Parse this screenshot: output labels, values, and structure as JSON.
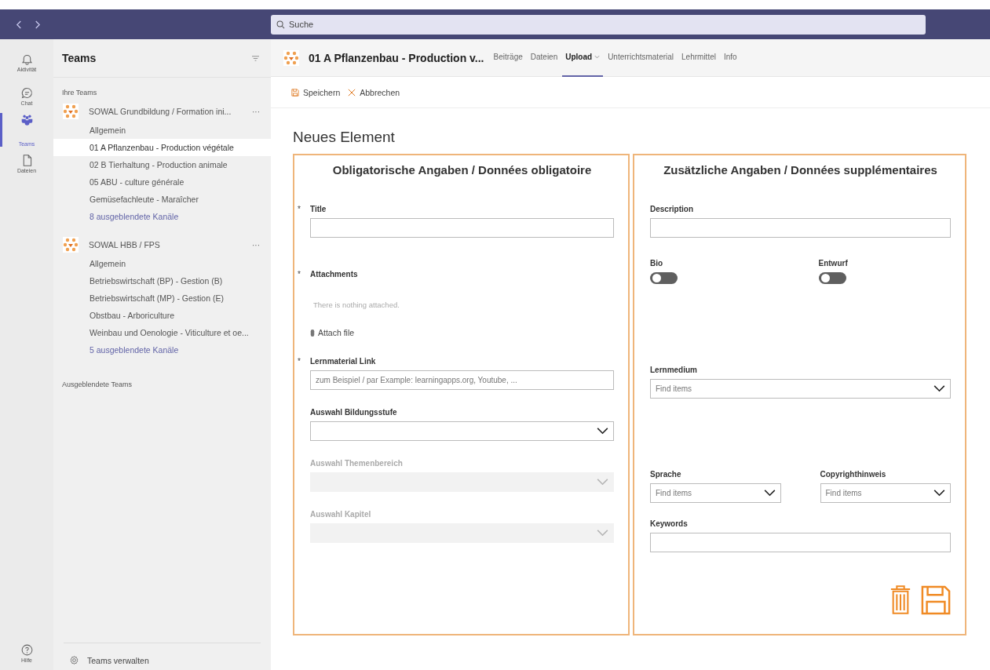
{
  "search": {
    "placeholder": "Suche"
  },
  "rail": {
    "items": [
      {
        "label": "Aktivität",
        "kind": "bell",
        "selected": false
      },
      {
        "label": "Chat",
        "kind": "chat",
        "selected": false
      },
      {
        "label": "Teams",
        "kind": "people",
        "selected": true
      },
      {
        "label": "Dateien",
        "kind": "file",
        "selected": false
      }
    ],
    "help": {
      "label": "Hilfe"
    }
  },
  "teams_panel": {
    "title": "Teams",
    "section": "Ihre Teams",
    "teams": [
      {
        "name": "SOWAL Grundbildung / Formation ini...",
        "more": "···",
        "channels": [
          {
            "label": "Allgemein",
            "kind": "channel",
            "selected": false
          },
          {
            "label": "01 A Pflanzenbau - Production végétale",
            "kind": "channel",
            "selected": true
          },
          {
            "label": "02 B Tierhaltung - Production animale",
            "kind": "channel",
            "selected": false
          },
          {
            "label": "05 ABU - culture générale",
            "kind": "channel",
            "selected": false
          },
          {
            "label": "Gemüsefachleute - Maraîcher",
            "kind": "channel",
            "selected": false
          },
          {
            "label": "8 ausgeblendete Kanäle",
            "kind": "link",
            "selected": false
          }
        ]
      },
      {
        "name": "SOWAL HBB / FPS",
        "more": "···",
        "channels": [
          {
            "label": "Allgemein",
            "kind": "channel",
            "selected": false
          },
          {
            "label": "Betriebswirtschaft (BP) - Gestion (B)",
            "kind": "channel",
            "selected": false
          },
          {
            "label": "Betriebswirtschaft (MP) - Gestion (E)",
            "kind": "channel",
            "selected": false
          },
          {
            "label": "Obstbau - Arboriculture",
            "kind": "channel",
            "selected": false
          },
          {
            "label": "Weinbau und Oenologie - Viticulture et oe...",
            "kind": "channel",
            "selected": false
          },
          {
            "label": "5 ausgeblendete Kanäle",
            "kind": "link",
            "selected": false
          }
        ]
      }
    ],
    "hidden_section": "Ausgeblendete Teams",
    "manage": "Teams verwalten"
  },
  "header": {
    "title": "01 A Pflanzenbau - Production v...",
    "tabs": [
      {
        "label": "Beiträge",
        "selected": false,
        "dropdown": false
      },
      {
        "label": "Dateien",
        "selected": false,
        "dropdown": false
      },
      {
        "label": "Upload",
        "selected": true,
        "dropdown": true
      },
      {
        "label": "Unterrichtsmaterial",
        "selected": false,
        "dropdown": false
      },
      {
        "label": "Lehrmittel",
        "selected": false,
        "dropdown": false
      },
      {
        "label": "Info",
        "selected": false,
        "dropdown": false
      }
    ]
  },
  "toolbar": [
    {
      "label": "Speichern",
      "kind": "save"
    },
    {
      "label": "Abbrechen",
      "kind": "cancel"
    }
  ],
  "form": {
    "heading": "Neues Element",
    "panels": [
      {
        "title": "Obligatorische Angaben / Données obligatoire",
        "rows": [
          [
            {
              "kind": "text",
              "label": "Title",
              "required_mark": "*"
            }
          ],
          [
            {
              "kind": "attachments",
              "label": "Attachments",
              "required_mark": "*",
              "empty_text": "There is nothing attached.",
              "action": "Attach file"
            }
          ],
          [
            {
              "kind": "text",
              "label": "Lernmaterial Link",
              "required_mark": "*",
              "placeholder": "zum Beispiel / par Example: learningapps.org, Youtube, ..."
            }
          ],
          [
            {
              "kind": "select",
              "label": "Auswahl Bildungsstufe",
              "disabled": false
            }
          ],
          [
            {
              "kind": "select",
              "label": "Auswahl Themenbereich",
              "disabled": true
            }
          ],
          [
            {
              "kind": "select",
              "label": "Auswahl Kapitel",
              "disabled": true
            }
          ]
        ]
      },
      {
        "title": "Zusätzliche Angaben / Données supplémentaires",
        "rows": [
          [
            {
              "kind": "text",
              "label": "Description"
            }
          ],
          [
            {
              "kind": "toggle",
              "label": "Bio",
              "on": false
            },
            {
              "kind": "toggle",
              "label": "Entwurf",
              "on": false
            }
          ],
          [
            {
              "kind": "select",
              "label": "Lernmedium",
              "disabled": false,
              "placeholder": "Find items"
            }
          ],
          [
            {
              "kind": "select",
              "label": "Sprache",
              "disabled": false,
              "placeholder": "Find items"
            },
            {
              "kind": "select",
              "label": "Copyrighthinweis",
              "disabled": false,
              "placeholder": "Find items"
            }
          ],
          [
            {
              "kind": "text",
              "label": "Keywords"
            }
          ]
        ]
      }
    ]
  }
}
